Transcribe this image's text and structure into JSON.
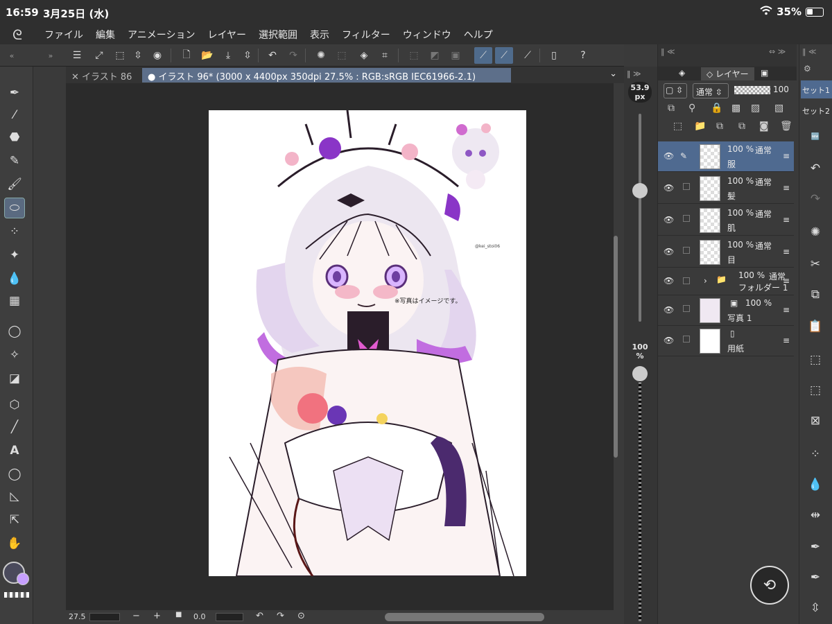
{
  "status": {
    "time": "16:59",
    "date": "3月25日 (水)",
    "battery": "35%"
  },
  "menu": [
    "ファイル",
    "編集",
    "アニメーション",
    "レイヤー",
    "選択範囲",
    "表示",
    "フィルター",
    "ウィンドウ",
    "ヘルプ"
  ],
  "tabs": [
    {
      "label": "イラスト 86"
    },
    {
      "label": "イラスト 96* (3000 x 4400px 350dpi 27.5% : RGB:sRGB IEC61966-2.1)"
    }
  ],
  "canvas": {
    "note": "※写真はイメージです。",
    "handle": "@kei_stoi06"
  },
  "brush": {
    "size_value": "53.9",
    "size_unit": "px",
    "opacity_value": "100",
    "opacity_unit": "%"
  },
  "bottom": {
    "zoom": "27.5",
    "rotate": "0.0"
  },
  "layer_panel": {
    "tab": "レイヤー",
    "blend_mode": "通常",
    "opacity": "100",
    "layers": [
      {
        "name": "服",
        "opacity": "100 %",
        "mode": "通常"
      },
      {
        "name": "髪",
        "opacity": "100 %",
        "mode": "通常"
      },
      {
        "name": "肌",
        "opacity": "100 %",
        "mode": "通常"
      },
      {
        "name": "目",
        "opacity": "100 %",
        "mode": "通常"
      },
      {
        "name": "フォルダー 1",
        "opacity": "100 %",
        "mode": "通常"
      },
      {
        "name": "写真 1",
        "opacity": "100 %",
        "mode": ""
      },
      {
        "name": "用紙",
        "opacity": "",
        "mode": ""
      }
    ]
  },
  "rightbar": {
    "set1": "セット1",
    "set2": "セット2"
  },
  "colors": {
    "accent": "#4f6a90",
    "main_color": "#4a4a5c",
    "sub_color": "#c7a0ff"
  }
}
